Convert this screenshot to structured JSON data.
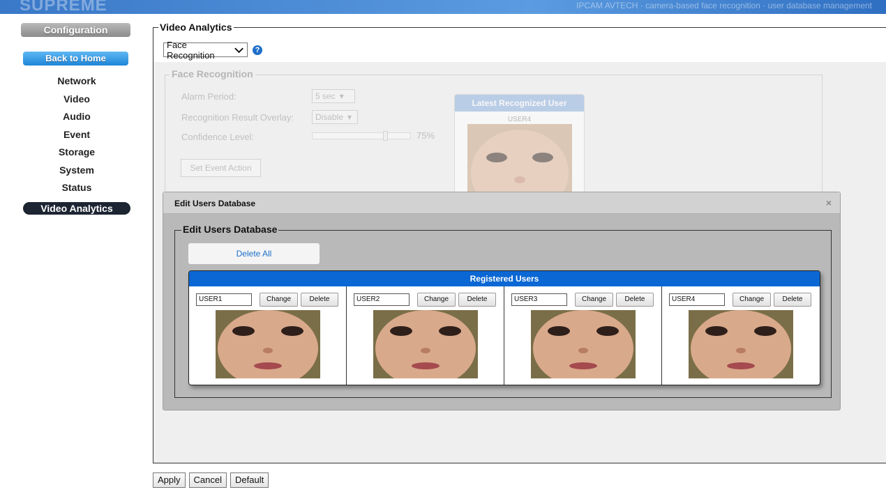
{
  "header": {
    "brand": "SUPREME",
    "marquee": "IPCAM AVTECH · camera-based face recognition · user database management"
  },
  "sidebar": {
    "configuration_label": "Configuration",
    "back_home_label": "Back to Home",
    "items": [
      "Network",
      "Video",
      "Audio",
      "Event",
      "Storage",
      "System",
      "Status",
      "Video Analytics"
    ],
    "active_item": "Video Analytics"
  },
  "main": {
    "section_title": "Video Analytics",
    "analytics_select": "Face Recognition",
    "face_recognition": {
      "legend": "Face Recognition",
      "alarm_period_label": "Alarm Period:",
      "alarm_period_value": "5 sec",
      "overlay_label": "Recognition Result Overlay:",
      "overlay_value": "Disable",
      "confidence_label": "Confidence Level:",
      "confidence_value": "75%",
      "confidence_fraction": 0.75,
      "set_event_label": "Set Event Action",
      "latest_title": "Latest Recognized User",
      "latest_user": "USER4"
    }
  },
  "modal": {
    "title": "Edit Users Database",
    "legend": "Edit Users Database",
    "delete_all_label": "Delete All",
    "registered_title": "Registered Users",
    "change_label": "Change",
    "delete_label": "Delete",
    "users": [
      "USER1",
      "USER2",
      "USER3",
      "USER4"
    ]
  },
  "footer": {
    "apply_label": "Apply",
    "cancel_label": "Cancel",
    "default_label": "Default"
  },
  "colors": {
    "accent": "#0a67d4",
    "active_menu": "#1d2533",
    "home_button": "#1d86d8"
  }
}
